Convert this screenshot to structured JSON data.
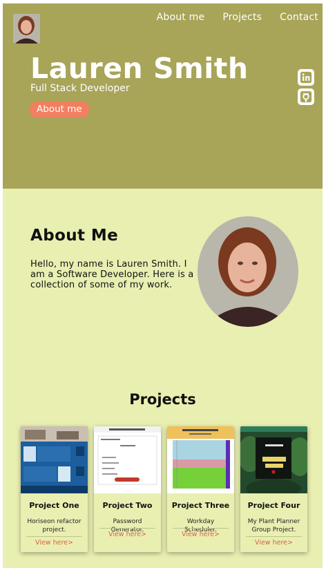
{
  "nav": {
    "items": [
      {
        "label": "About me"
      },
      {
        "label": "Projects"
      },
      {
        "label": "Contact"
      }
    ]
  },
  "hero": {
    "name": "Lauren Smith",
    "role": "Full Stack Developer",
    "button_label": "About me"
  },
  "social": {
    "icons": [
      "linkedin-icon",
      "github-icon"
    ]
  },
  "about": {
    "title": "About Me",
    "text": "Hello, my name is Lauren Smith. I am a Software Developer. Here is a collection of some of my work."
  },
  "projects": {
    "title": "Projects",
    "cards": [
      {
        "title": "Project One",
        "description": "Horiseon refactor project.",
        "link": "View here>"
      },
      {
        "title": "Project Two",
        "description": "Password Generator.",
        "link": "View here>"
      },
      {
        "title": "Project Three",
        "description": "Workday Scheduler.",
        "link": "View here>"
      },
      {
        "title": "Project Four",
        "description": "My Plant Planner Group Project.",
        "link": "View here>"
      }
    ]
  },
  "colors": {
    "hero_background": "#a8a458",
    "page_background": "#e9efb1",
    "accent": "#f08060",
    "link": "#d9604a"
  }
}
